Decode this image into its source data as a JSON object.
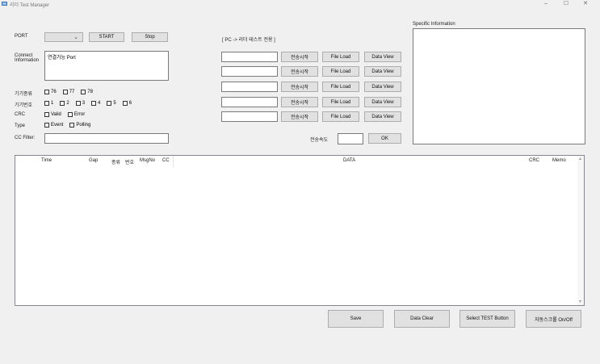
{
  "window": {
    "title": "리더 Test Manager",
    "minimize": "–",
    "maximize": "☐",
    "close": "✕"
  },
  "port": {
    "label": "PORT",
    "selected": "",
    "start_label": "START",
    "stop_label": "Stop"
  },
  "connect": {
    "label_line1": "Connect",
    "label_line2": "Information",
    "text": "연결가능 Port"
  },
  "device_kind": {
    "label": "기기종류",
    "options": [
      "76",
      "77",
      "78"
    ]
  },
  "device_no": {
    "label": "기기번호",
    "options": [
      "1",
      "2",
      "3",
      "4",
      "5",
      "6"
    ]
  },
  "crc": {
    "label": "CRC",
    "options": [
      "Valid",
      "Error"
    ]
  },
  "type": {
    "label": "Type",
    "options": [
      "Event",
      "Polling"
    ]
  },
  "cc_filter": {
    "label": "CC Filter:",
    "value": ""
  },
  "pc_test": {
    "title": "[ PC -> 리더 테스트 전용 ]",
    "rows": [
      {
        "value": "",
        "send": "전송시작",
        "load": "File Load",
        "view": "Data View"
      },
      {
        "value": "",
        "send": "전송시작",
        "load": "File Load",
        "view": "Data View"
      },
      {
        "value": "",
        "send": "전송시작",
        "load": "File Load",
        "view": "Data View"
      },
      {
        "value": "",
        "send": "전송시작",
        "load": "File Load",
        "view": "Data View"
      },
      {
        "value": "",
        "send": "전송시작",
        "load": "File Load",
        "view": "Data View"
      }
    ],
    "speed_label": "전송속도",
    "speed_value": "",
    "ok_label": "OK"
  },
  "specific": {
    "label": "Specific Information",
    "text": ""
  },
  "grid": {
    "columns": [
      "Time",
      "Gap",
      "종류",
      "번호",
      "MsgNo",
      "CC",
      "DATA",
      "CRC",
      "Memo"
    ]
  },
  "bottom": {
    "save": "Save",
    "clear": "Data Clear",
    "select_test": "Select TEST Button",
    "autoscroll": "자동스크롤 On/Off"
  }
}
